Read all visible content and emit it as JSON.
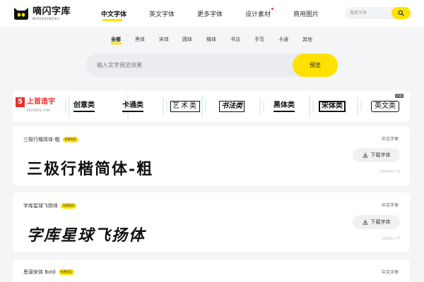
{
  "header": {
    "logo_title": "嘀闪字库",
    "logo_sub": "MIAOSHANZIKU",
    "nav": [
      {
        "label": "中文字体",
        "active": true
      },
      {
        "label": "英文字体",
        "active": false
      },
      {
        "label": "更多字体",
        "active": false
      },
      {
        "label": "设计素材",
        "active": false,
        "dot": true
      },
      {
        "label": "商用图片",
        "active": false
      }
    ],
    "search_placeholder": "搜索字体"
  },
  "categories": [
    {
      "label": "全部",
      "active": true
    },
    {
      "label": "黑体"
    },
    {
      "label": "宋体"
    },
    {
      "label": "圆体"
    },
    {
      "label": "楷体"
    },
    {
      "label": "书法"
    },
    {
      "label": "手写"
    },
    {
      "label": "卡通"
    },
    {
      "label": "其他"
    }
  ],
  "preview": {
    "placeholder": "输入文字预览效果",
    "button_label": "预览"
  },
  "banner": {
    "brand_mark": "5",
    "brand_title": "上首造字",
    "brand_url": "SSFONTS.COM",
    "tags": [
      "创意类",
      "卡通类",
      "艺术类",
      "书法类",
      "黑体类",
      "宋体类",
      "英文类"
    ],
    "ad_label": "广告"
  },
  "fonts": [
    {
      "name": "三极行楷简体-粗",
      "badge": "免费商用",
      "preview_text": "三极行楷简体-粗",
      "type": "中文字体",
      "download_label": "下载字体",
      "popularity": "100484人气"
    },
    {
      "name": "字库星球飞扬体",
      "badge": "免费商用",
      "preview_text": "字库星球飞扬体",
      "type": "中文字体",
      "download_label": "下载字体",
      "popularity": "10665人气"
    },
    {
      "name": "思源宋体 Bold",
      "badge": "免费商用",
      "type": "中文字体"
    }
  ],
  "colors": {
    "accent": "#ffe100",
    "brand_red": "#e8322b",
    "background": "#f4f5f7"
  }
}
